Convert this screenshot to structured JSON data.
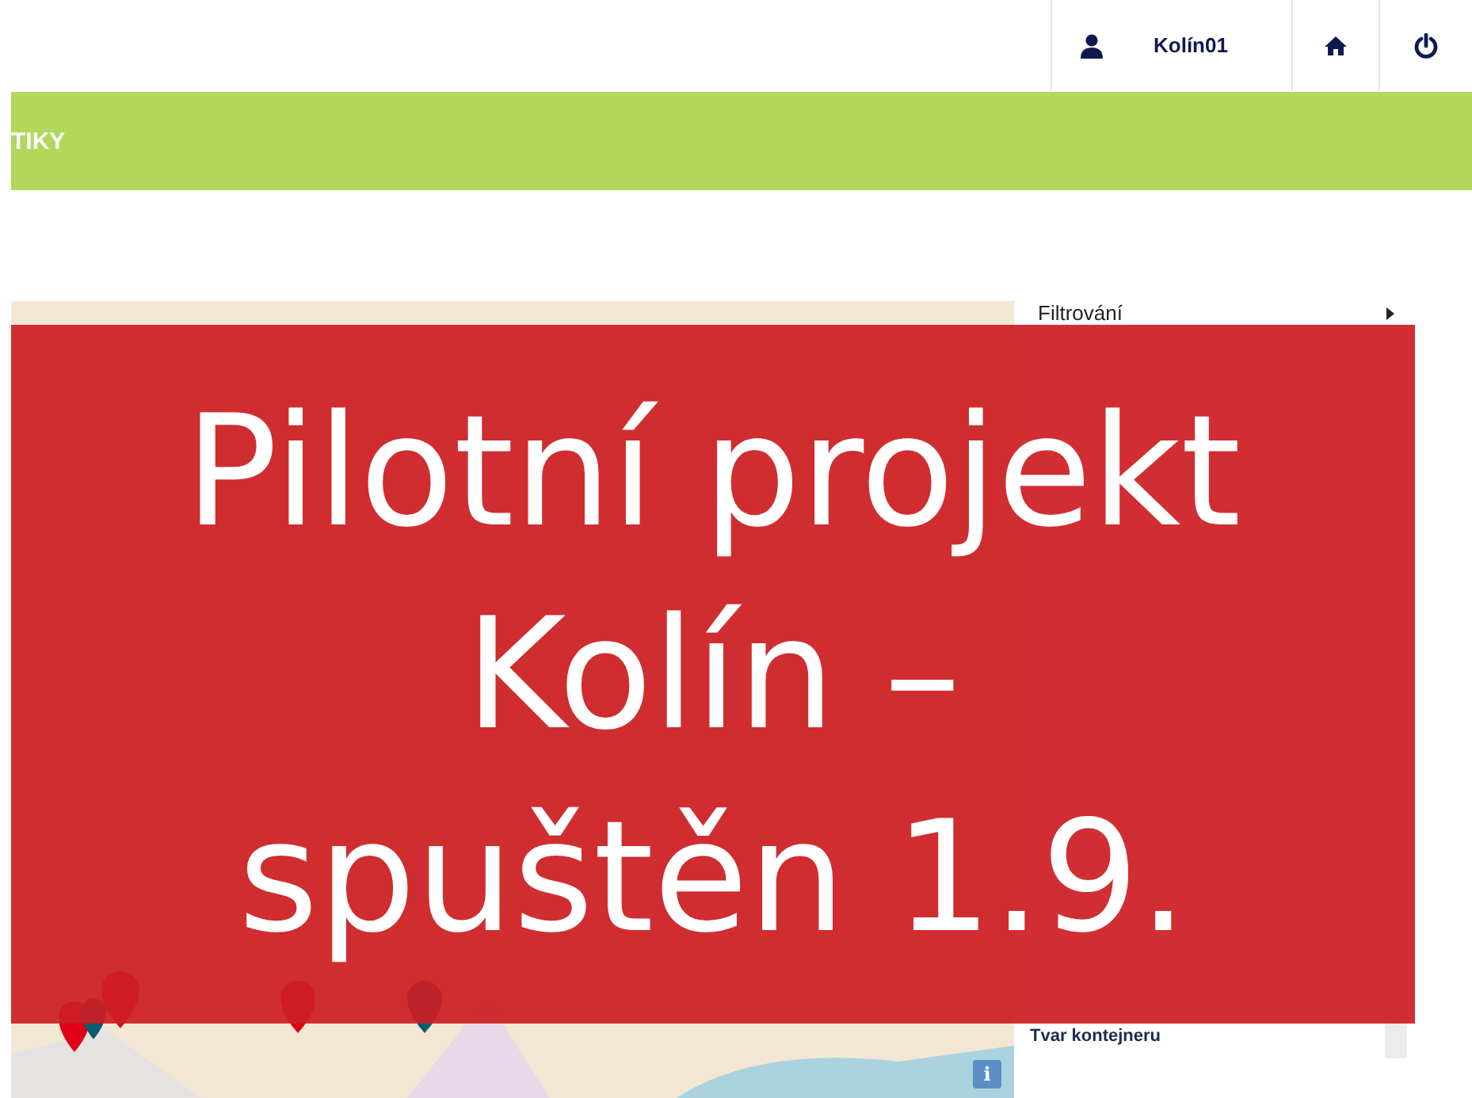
{
  "header": {
    "user": "Kolín01"
  },
  "nav_bar": {
    "title": "TIKY"
  },
  "sidebar": {
    "title": "Filtrování",
    "section": "Tvar kontejneru"
  },
  "map": {
    "info_button": "i"
  },
  "banner": {
    "lines": [
      "Pilotní projekt",
      "Kolín –",
      "spuštěn 1.9."
    ]
  }
}
